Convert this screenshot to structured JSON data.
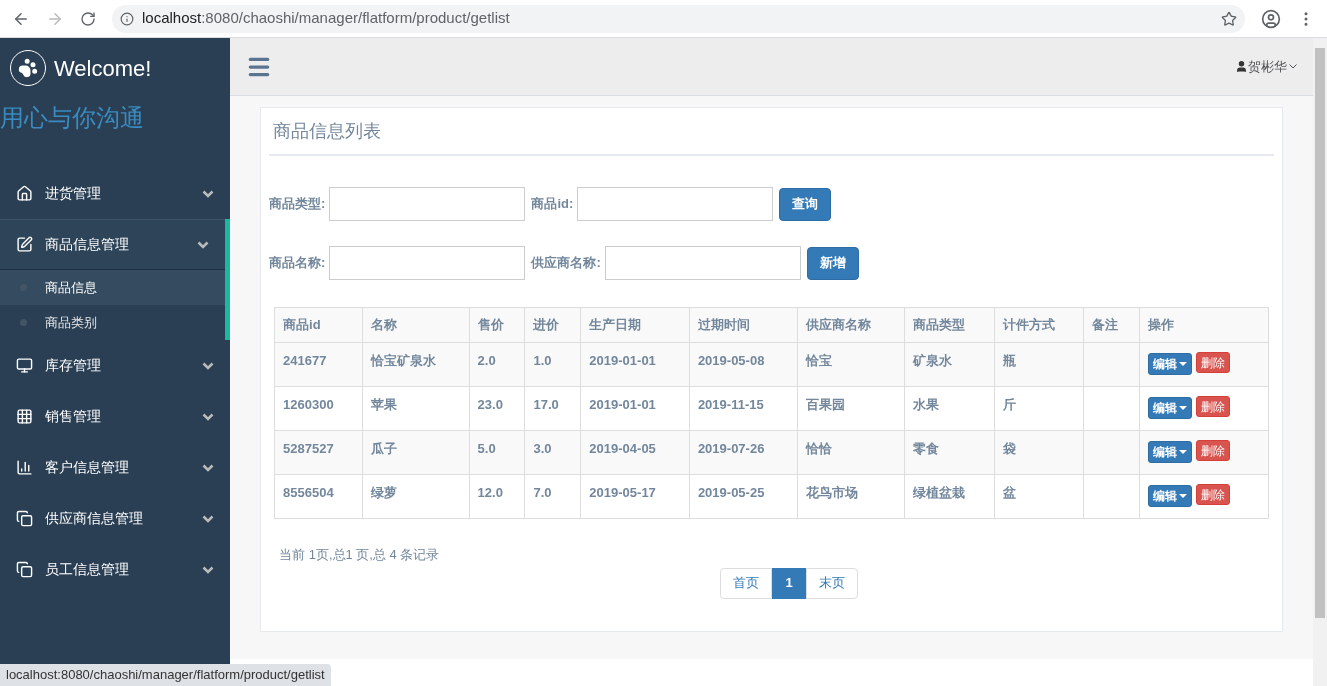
{
  "browser": {
    "url_host": "localhost",
    "url_path": ":8080/chaoshi/manager/flatform/product/getlist"
  },
  "sidebar": {
    "brand": "Welcome!",
    "slogan": "用心与你沟通",
    "items": [
      {
        "label": "进货管理",
        "expanded": false
      },
      {
        "label": "商品信息管理",
        "expanded": true,
        "children": [
          {
            "label": "商品信息",
            "selected": true
          },
          {
            "label": "商品类别",
            "selected": false
          }
        ]
      },
      {
        "label": "库存管理",
        "expanded": false
      },
      {
        "label": "销售管理",
        "expanded": false
      },
      {
        "label": "客户信息管理",
        "expanded": false
      },
      {
        "label": "供应商信息管理",
        "expanded": false
      },
      {
        "label": "员工信息管理",
        "expanded": false
      }
    ]
  },
  "header": {
    "user": "贺彬华"
  },
  "panel": {
    "title": "商品信息列表",
    "filters": [
      [
        {
          "label": "商品类型:"
        },
        {
          "label": "商品id:"
        },
        {
          "button": "查询"
        }
      ],
      [
        {
          "label": "商品名称:"
        },
        {
          "label": "供应商名称:"
        },
        {
          "button": "新增"
        }
      ]
    ],
    "table": {
      "columns": [
        "商品id",
        "名称",
        "售价",
        "进价",
        "生产日期",
        "过期时间",
        "供应商名称",
        "商品类型",
        "计件方式",
        "备注",
        "操作"
      ],
      "rows": [
        {
          "cells": [
            "241677",
            "恰宝矿泉水",
            "2.0",
            "1.0",
            "2019-01-01",
            "2019-05-08",
            "恰宝",
            "矿泉水",
            "瓶"
          ],
          "edit": "编辑",
          "delete": "删除"
        },
        {
          "cells": [
            "1260300",
            "苹果",
            "23.0",
            "17.0",
            "2019-01-01",
            "2019-11-15",
            "百果园",
            "水果",
            "斤"
          ],
          "edit": "编辑",
          "delete": "删除"
        },
        {
          "cells": [
            "5287527",
            "瓜子",
            "5.0",
            "3.0",
            "2019-04-05",
            "2019-07-26",
            "恰恰",
            "零食",
            "袋"
          ],
          "edit": "编辑",
          "delete": "删除"
        },
        {
          "cells": [
            "8556504",
            "绿萝",
            "12.0",
            "7.0",
            "2019-05-17",
            "2019-05-25",
            "花鸟市场",
            "绿植盆栽",
            "盆"
          ],
          "edit": "编辑",
          "delete": "删除"
        }
      ]
    },
    "summary": "当前 1页,总1 页,总 4 条记录",
    "pagination": [
      {
        "label": "首页",
        "selected": false
      },
      {
        "label": "1",
        "selected": true
      },
      {
        "label": "末页",
        "selected": false
      }
    ]
  },
  "status_bar": "localhost:8080/chaoshi/manager/flatform/product/getlist"
}
